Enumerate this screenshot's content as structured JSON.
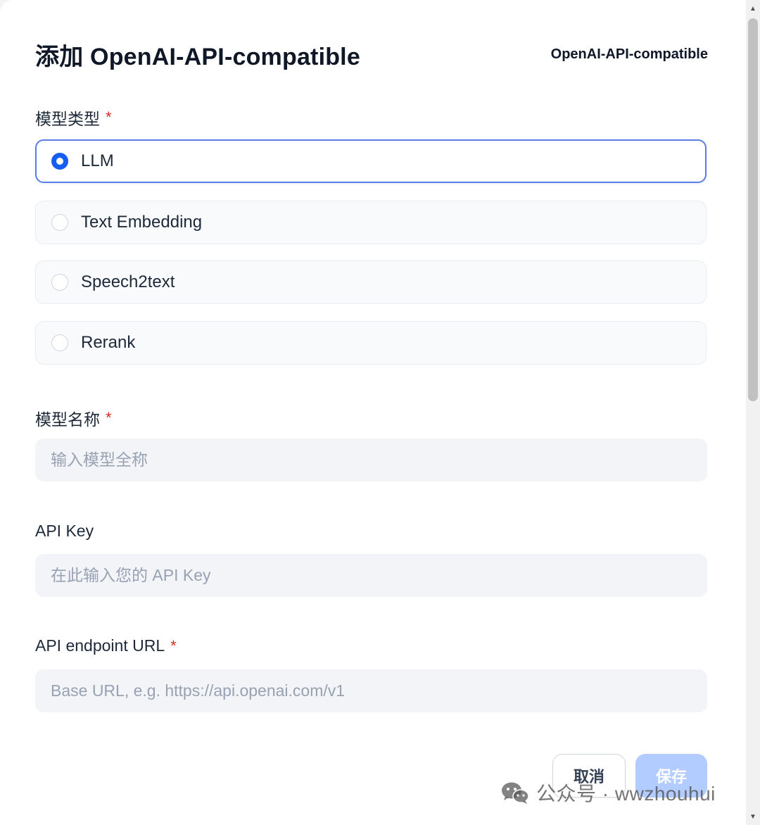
{
  "modal": {
    "title": "添加 OpenAI-API-compatible",
    "provider_badge": "OpenAI-API-compatible"
  },
  "model_type": {
    "label": "模型类型",
    "required_mark": "*",
    "options": [
      {
        "label": "LLM",
        "selected": true
      },
      {
        "label": "Text Embedding",
        "selected": false
      },
      {
        "label": "Speech2text",
        "selected": false
      },
      {
        "label": "Rerank",
        "selected": false
      }
    ]
  },
  "model_name": {
    "label": "模型名称",
    "required_mark": "*",
    "placeholder": "输入模型全称",
    "value": ""
  },
  "api_key": {
    "label": "API Key",
    "placeholder": "在此输入您的 API Key",
    "value": ""
  },
  "endpoint_url": {
    "label": "API endpoint URL",
    "required_mark": "*",
    "placeholder": "Base URL, e.g. https://api.openai.com/v1",
    "value": ""
  },
  "footer": {
    "cancel_label": "取消",
    "save_label": "保存"
  },
  "watermark": {
    "text": "公众号 · wwzhouhui",
    "icon": "wechat-icon"
  },
  "colors": {
    "accent": "#155eef",
    "selected_border": "#5b7ee5",
    "required": "#d92d20",
    "save_disabled": "#b2ccff"
  }
}
